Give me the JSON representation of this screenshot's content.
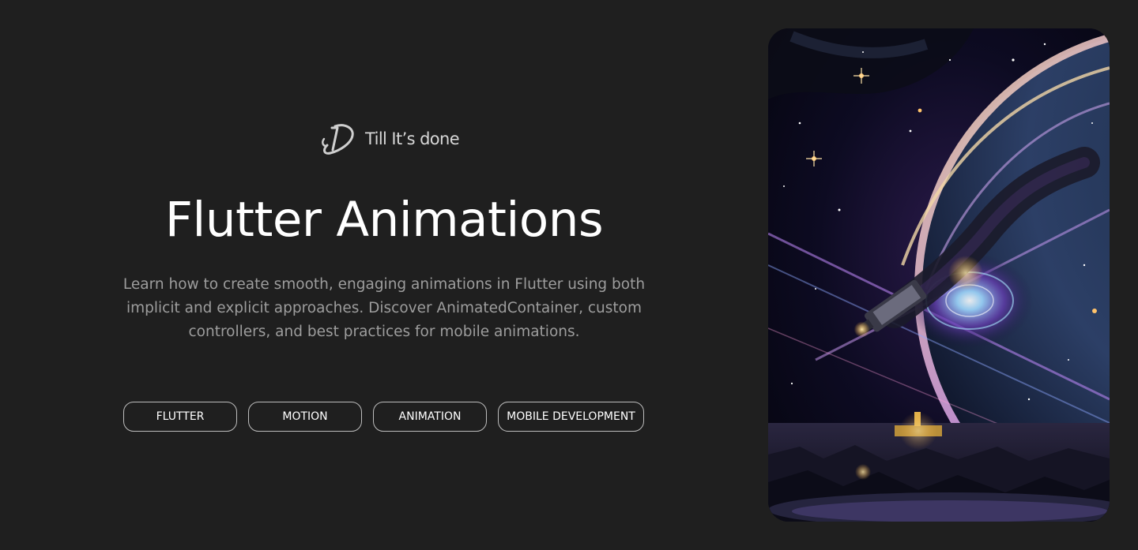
{
  "brand": {
    "name": "Till It’s done",
    "logo_icon": "td-monogram-logo"
  },
  "hero": {
    "title": "Flutter Animations",
    "description": "Learn how to create smooth, engaging animations in Flutter using both implicit and explicit approaches. Discover AnimatedContainer, custom controllers, and best practices for mobile animations."
  },
  "tags": [
    {
      "label": "FLUTTER"
    },
    {
      "label": "MOTION"
    },
    {
      "label": "ANIMATION"
    },
    {
      "label": "MOBILE DEVELOPMENT"
    }
  ],
  "cover_image": {
    "subject": "space-scene-illustration"
  },
  "colors": {
    "background": "#1f1f1f",
    "title": "#ffffff",
    "description": "#9d9d9d",
    "tag_border": "#bdbdbd",
    "brand_text": "#d7d7d7"
  }
}
